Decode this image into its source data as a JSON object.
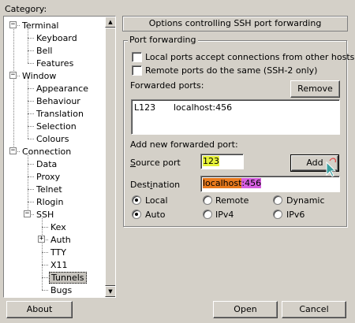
{
  "category": {
    "label": "Category:",
    "tree": [
      {
        "label": "Terminal",
        "expander": "−"
      },
      {
        "label": "Keyboard"
      },
      {
        "label": "Bell"
      },
      {
        "label": "Features"
      },
      {
        "label": "Window",
        "expander": "−"
      },
      {
        "label": "Appearance"
      },
      {
        "label": "Behaviour"
      },
      {
        "label": "Translation"
      },
      {
        "label": "Selection"
      },
      {
        "label": "Colours"
      },
      {
        "label": "Connection",
        "expander": "−"
      },
      {
        "label": "Data"
      },
      {
        "label": "Proxy"
      },
      {
        "label": "Telnet"
      },
      {
        "label": "Rlogin"
      },
      {
        "label": "SSH",
        "expander": "−"
      },
      {
        "label": "Kex"
      },
      {
        "label": "Auth",
        "expander": "+"
      },
      {
        "label": "TTY"
      },
      {
        "label": "X11"
      },
      {
        "label": "Tunnels",
        "selected": true
      },
      {
        "label": "Bugs"
      }
    ]
  },
  "panel": {
    "header": "Options controlling SSH port forwarding",
    "group_title": "Port forwarding",
    "local_accept": "Local ports accept connections from other hosts",
    "remote_same": "Remote ports do the same (SSH-2 only)",
    "forwarded_label": "Forwarded ports:",
    "remove_button": "Remove",
    "forwarded_entry": {
      "source": "L123",
      "dest": "localhost:456"
    },
    "add_new_label": "Add new forwarded port:",
    "source_label": "Source port",
    "source_value": "123",
    "add_button": "Add",
    "destination_label": "Destination",
    "destination_host": "localhost",
    "destination_port": ":456",
    "radio_local": "Local",
    "radio_remote": "Remote",
    "radio_dynamic": "Dynamic",
    "radio_auto": "Auto",
    "radio_ipv4": "IPv4",
    "radio_ipv6": "IPv6",
    "selected_direction": "Local",
    "selected_protocol": "Auto"
  },
  "footer": {
    "about": "About",
    "open": "Open",
    "cancel": "Cancel"
  },
  "colors": {
    "window_bg": "#d4d0c8",
    "highlight_yellow": "#e6f23a",
    "highlight_orange": "#e87a1e",
    "highlight_purple": "#d65fe0"
  }
}
